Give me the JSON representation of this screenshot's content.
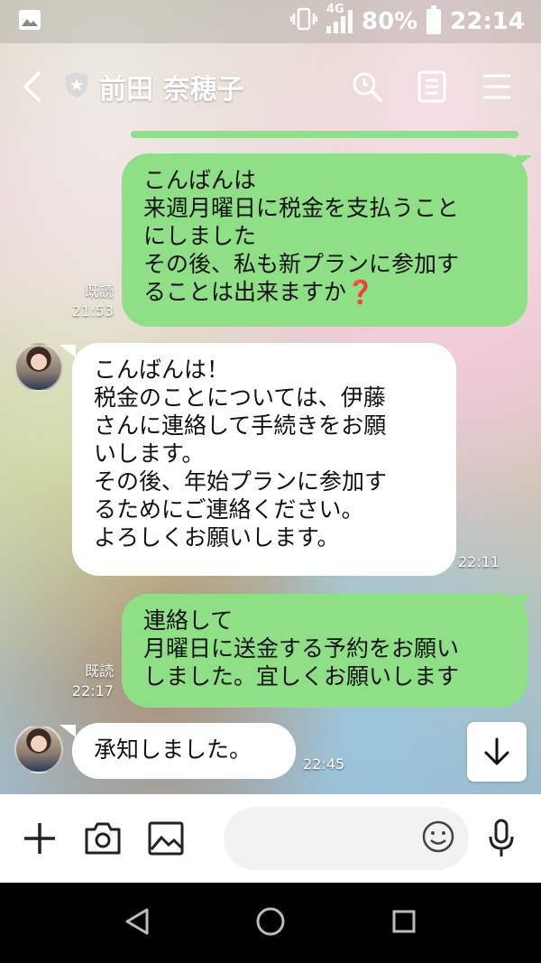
{
  "status_bar": {
    "network": "4G",
    "battery": "80%",
    "time": "22:14"
  },
  "header": {
    "contact_name": "前田 奈穂子"
  },
  "messages": [
    {
      "direction": "outgoing",
      "text": "こんばんは\n来週月曜日に税金を支払うこと\nにしました\nその後、私も新プランに参加す\nることは出来ますか❓",
      "read": "既読",
      "time": "21:53"
    },
    {
      "direction": "incoming",
      "text": "こんばんは！\n税金のことについては、伊藤\nさんに連絡して手続きをお願\nいします。\nその後、年始プランに参加す\nるためにご連絡ください。\nよろしくお願いします。",
      "time": "22:11"
    },
    {
      "direction": "outgoing",
      "text": "連絡して\n月曜日に送金する予約をお願い\nしました。宜しくお願いします",
      "read": "既読",
      "time": "22:17"
    },
    {
      "direction": "incoming",
      "text": "承知しました。",
      "time": "22:45"
    }
  ],
  "colors": {
    "outgoing_bubble": "#8fdf87",
    "incoming_bubble": "#ffffff"
  }
}
